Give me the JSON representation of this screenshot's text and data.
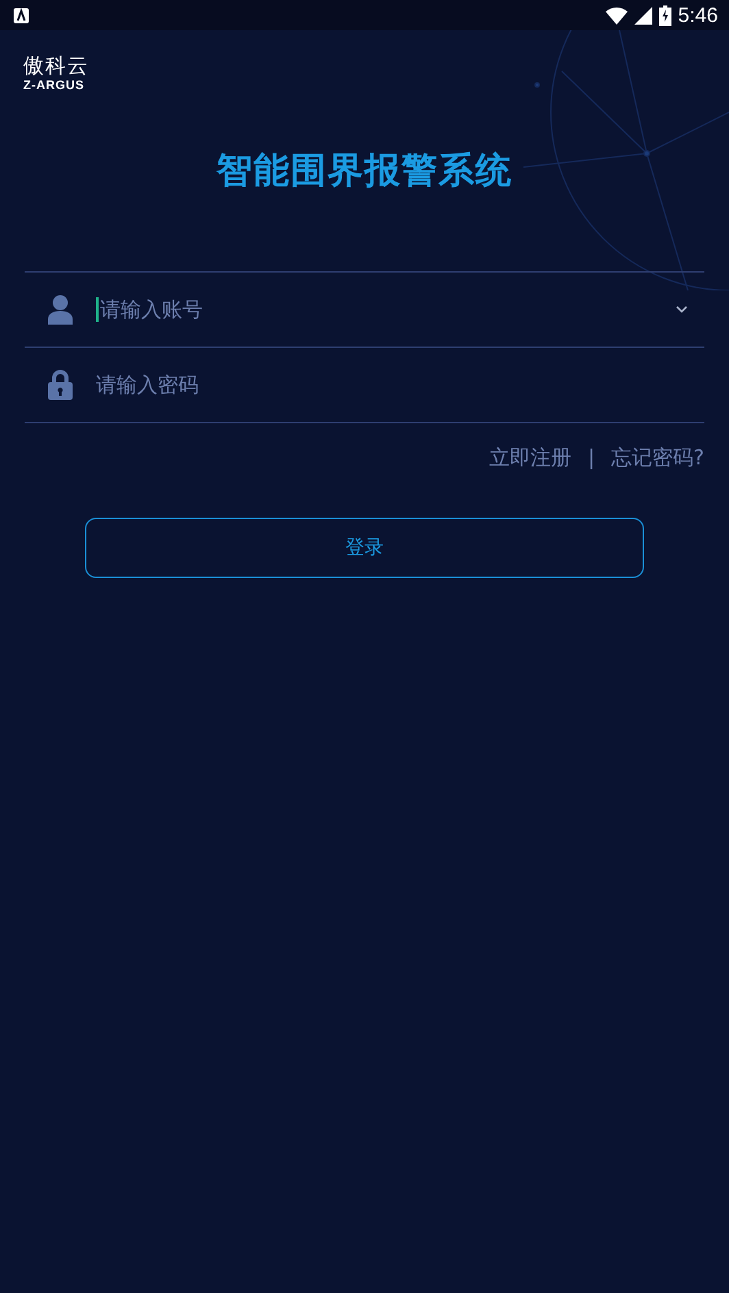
{
  "status_bar": {
    "time": "5:46"
  },
  "logo": {
    "name": "傲科云",
    "subtitle": "Z-ARGUS"
  },
  "title": "智能围界报警系统",
  "fields": [
    {
      "kind": "account",
      "placeholder": "请输入账号",
      "focused": true
    },
    {
      "kind": "password",
      "placeholder": "请输入密码",
      "focused": false
    }
  ],
  "links": {
    "register": "立即注册",
    "separator": "|",
    "forgot_password": "忘记密码?"
  },
  "login_button": "登录"
}
